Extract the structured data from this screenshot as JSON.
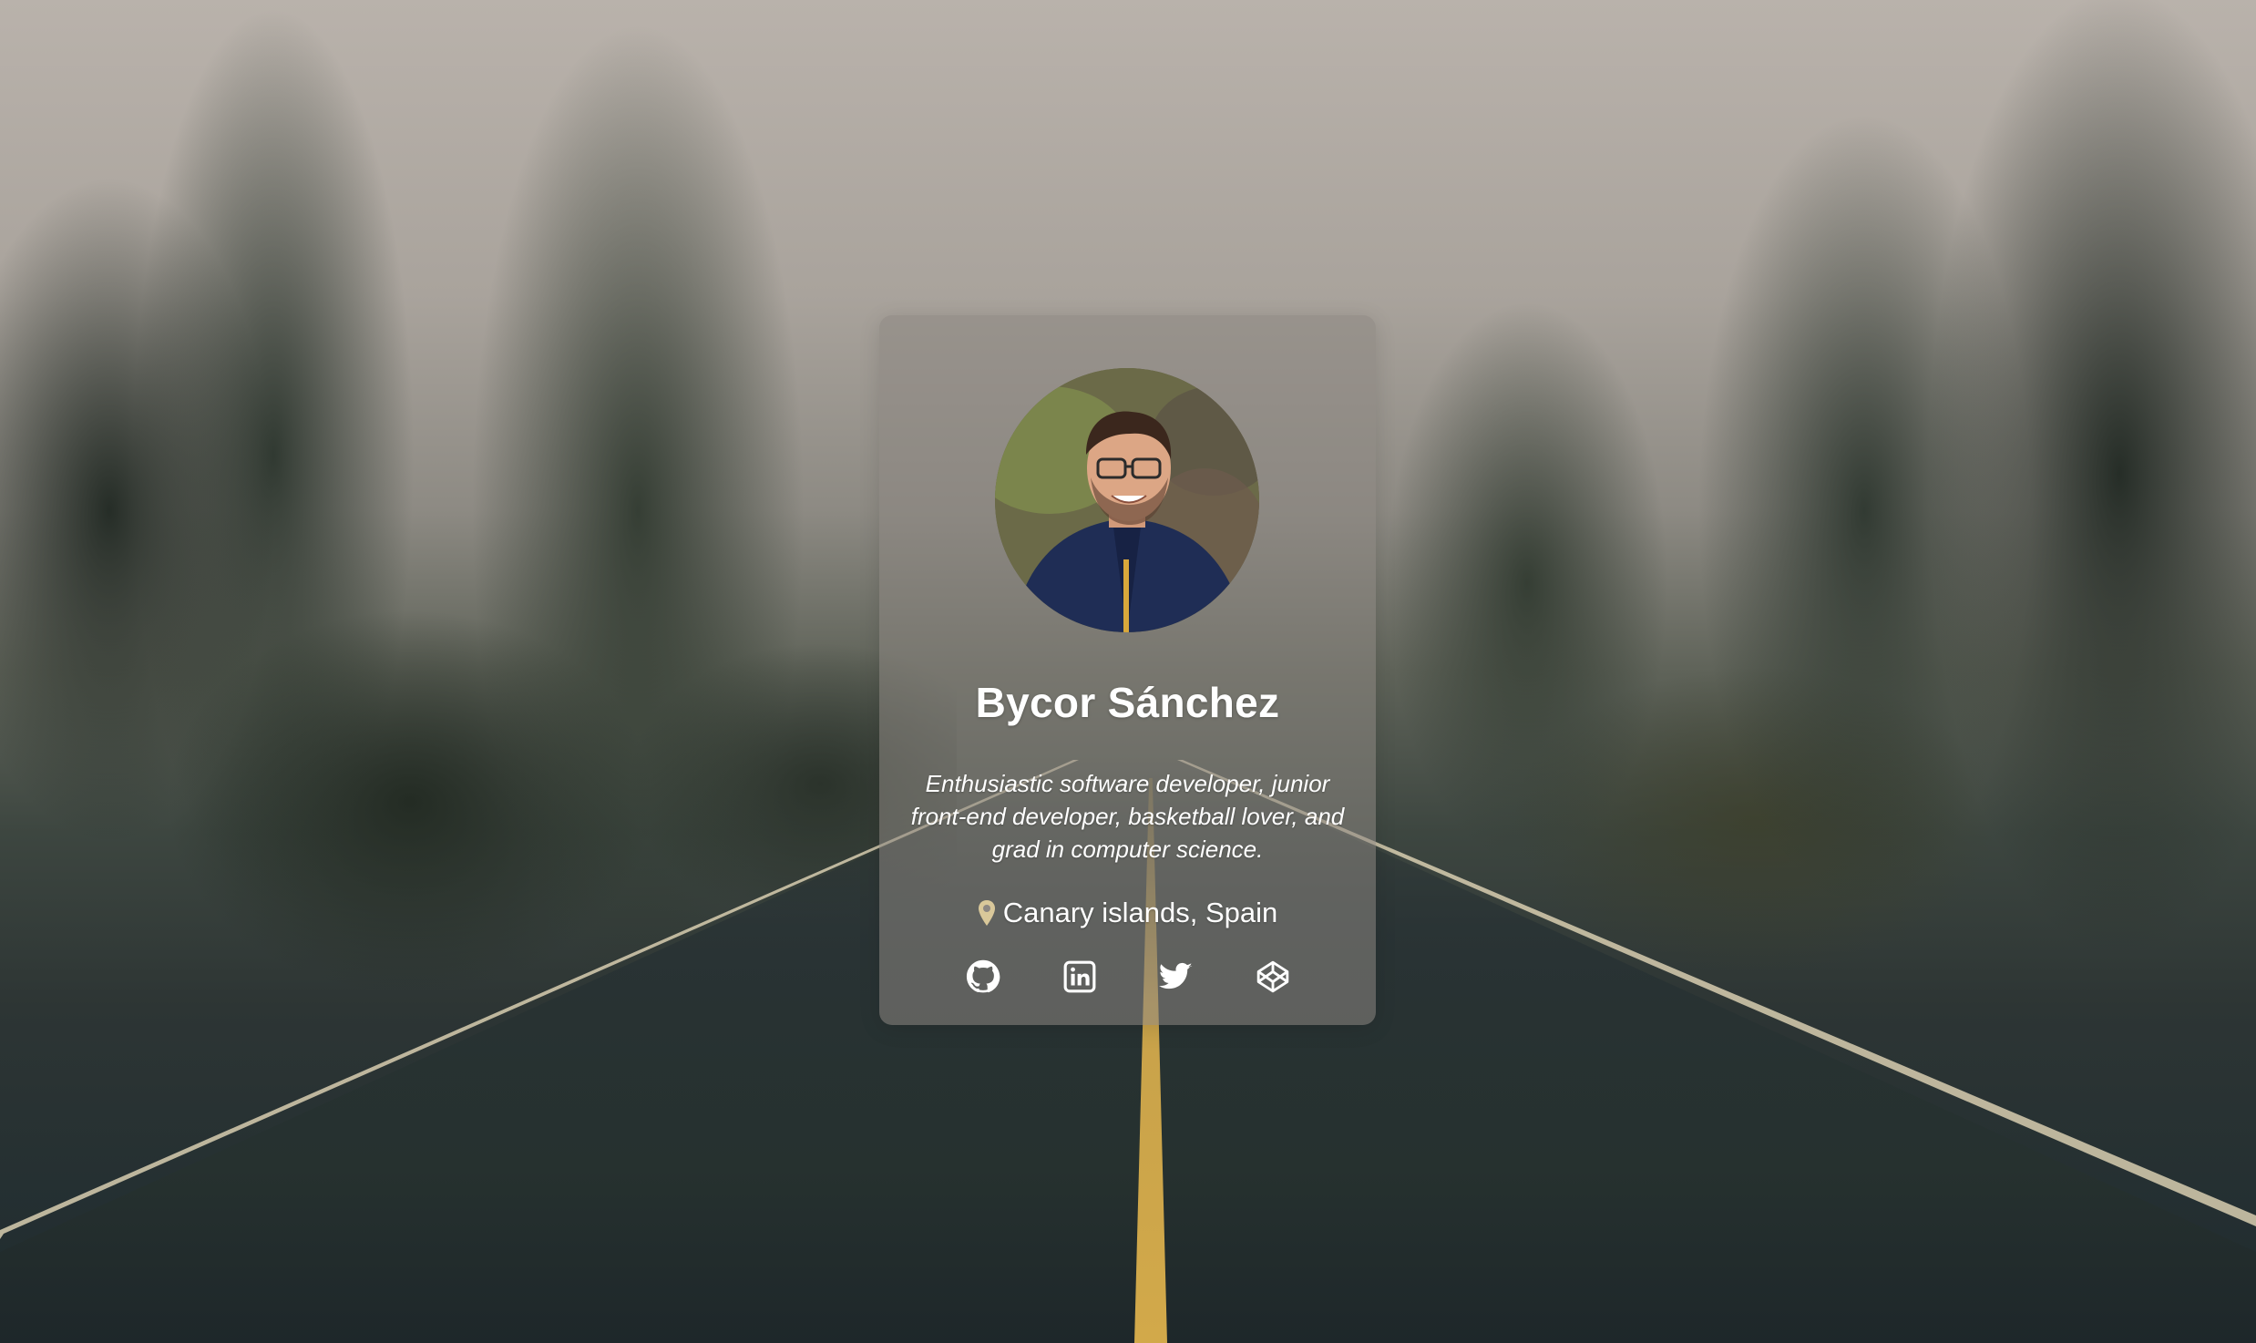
{
  "profile": {
    "name": "Bycor Sánchez",
    "bio": "Enthusiastic software developer, junior front-end developer, basketball lover, and grad in computer science.",
    "location": "Canary islands, Spain",
    "avatar_icon": "avatar-photo"
  },
  "social_links": [
    {
      "name": "github",
      "icon": "github-icon"
    },
    {
      "name": "linkedin",
      "icon": "linkedin-icon"
    },
    {
      "name": "twitter",
      "icon": "twitter-icon"
    },
    {
      "name": "codepen",
      "icon": "codepen-icon"
    }
  ],
  "colors": {
    "card_background": "#8c8782",
    "text": "#ffffff",
    "pin": "#d9c89a"
  }
}
